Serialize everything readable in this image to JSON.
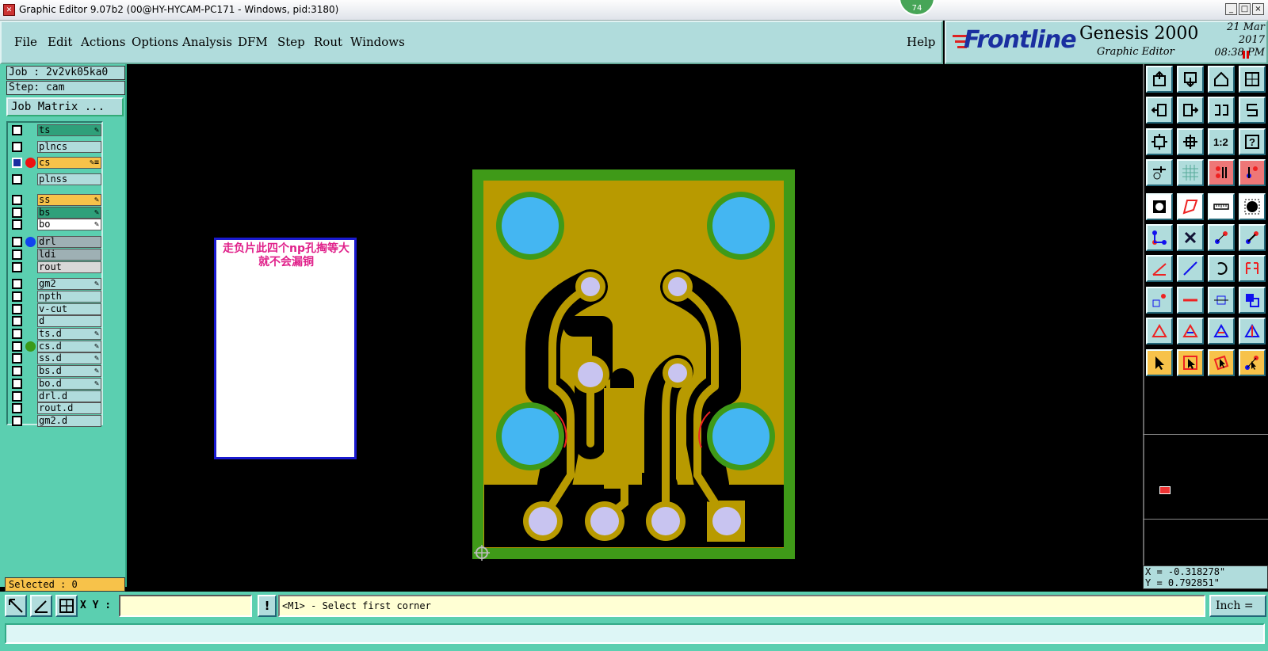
{
  "window": {
    "title": "Graphic Editor 9.07b2 (00@HY-HYCAM-PC171 - Windows, pid:3180)",
    "badge": "74",
    "buttons": [
      "_",
      "□",
      "×"
    ]
  },
  "menu": [
    "File",
    "Edit",
    "Actions",
    "Options",
    "Analysis",
    "DFM",
    "Step",
    "Rout",
    "Windows"
  ],
  "help_label": "Help",
  "branding": {
    "logo": "Frontline",
    "product": "Genesis 2000",
    "subtitle": "Graphic Editor",
    "date_line1": "21 Mar 2017",
    "date_line2": "08:38 PM"
  },
  "job": {
    "job_line": "Job : 2v2vk05ka0",
    "step_line": "Step: cam",
    "matrix_button": "Job Matrix ..."
  },
  "layers": [
    {
      "name": "ts",
      "bg": "#2fa07a",
      "dot": "",
      "flag": "✎"
    },
    {
      "name": "plncs",
      "bg": "#b0dcdc",
      "dot": "",
      "flag": ""
    },
    {
      "name": "cs",
      "bg": "#f7c24a",
      "dot": "#ee1111",
      "flag": "✎≡",
      "active": true
    },
    {
      "name": "plnss",
      "bg": "#b0dcdc",
      "dot": "",
      "flag": ""
    },
    {
      "name": "ss",
      "bg": "#f7c24a",
      "dot": "",
      "flag": "✎"
    },
    {
      "name": "bs",
      "bg": "#2fa07a",
      "dot": "",
      "flag": "✎"
    },
    {
      "name": "bo",
      "bg": "#ffffff",
      "dot": "",
      "flag": "✎"
    },
    {
      "name": "drl",
      "bg": "#9eb0b4",
      "dot": "#1144ee",
      "flag": ""
    },
    {
      "name": "ldi",
      "bg": "#9eb0b4",
      "dot": "",
      "flag": ""
    },
    {
      "name": "rout",
      "bg": "#d8d8d8",
      "dot": "",
      "flag": ""
    },
    {
      "name": "gm2",
      "bg": "#b0dcdc",
      "dot": "",
      "flag": "✎"
    },
    {
      "name": "npth",
      "bg": "#b0dcdc",
      "dot": "",
      "flag": ""
    },
    {
      "name": "v-cut",
      "bg": "#b0dcdc",
      "dot": "",
      "flag": ""
    },
    {
      "name": "d",
      "bg": "#b0dcdc",
      "dot": "",
      "flag": ""
    },
    {
      "name": "ts.d",
      "bg": "#b0dcdc",
      "dot": "",
      "flag": "✎"
    },
    {
      "name": "cs.d",
      "bg": "#b0dcdc",
      "dot": "#3a9a1a",
      "flag": "✎"
    },
    {
      "name": "ss.d",
      "bg": "#b0dcdc",
      "dot": "",
      "flag": "✎"
    },
    {
      "name": "bs.d",
      "bg": "#b0dcdc",
      "dot": "",
      "flag": "✎"
    },
    {
      "name": "bo.d",
      "bg": "#b0dcdc",
      "dot": "",
      "flag": "✎"
    },
    {
      "name": "drl.d",
      "bg": "#b0dcdc",
      "dot": "",
      "flag": ""
    },
    {
      "name": "rout.d",
      "bg": "#b0dcdc",
      "dot": "",
      "flag": ""
    },
    {
      "name": "gm2.d",
      "bg": "#b0dcdc",
      "dot": "",
      "flag": ""
    }
  ],
  "selected": "Selected : 0",
  "canvas": {
    "note": "走负片此四个np孔掏等大就不会漏铜",
    "colors": {
      "board": "#b89a00",
      "outline": "#3f9a18",
      "npth": "#44b6f2",
      "pad": "#c8c4f0",
      "trace": "#b89a00",
      "clearance": "#000000"
    }
  },
  "toolbar_icons": [
    "home-up-icon",
    "home-down-icon",
    "home-icon",
    "grid-corner-icon",
    "pan-left-icon",
    "pan-right-icon",
    "flip-icon",
    "snake-icon",
    "fit-icon",
    "zoom-fit-icon",
    "scale-1-2-icon",
    "help-icon",
    "paint-icon",
    "grid-icon",
    "layer-red-icon",
    "layer-blue-icon",
    "pad-icon",
    "polygon-icon",
    "ruler-icon",
    "dot-icon",
    "connect-icon",
    "cross-icon",
    "move-arrow-icon",
    "move-arrow2-icon",
    "angle-icon",
    "line-icon",
    "rotate-icon",
    "mirror-icon",
    "move-pt-icon",
    "line-red-icon",
    "resize-icon",
    "copy-icon",
    "tri-icon",
    "tri2-icon",
    "tri3-icon",
    "tri4-icon",
    "select-icon",
    "select-box-icon",
    "select-poly-icon",
    "select-net-icon"
  ],
  "coords": {
    "x": "X = -0.318278\"",
    "y": "Y = 0.792851\""
  },
  "bottom": {
    "xy_label": "X Y :",
    "xy_value": "",
    "bang": "!",
    "prompt": "<M1> - Select first corner",
    "unit": "Inch ="
  }
}
